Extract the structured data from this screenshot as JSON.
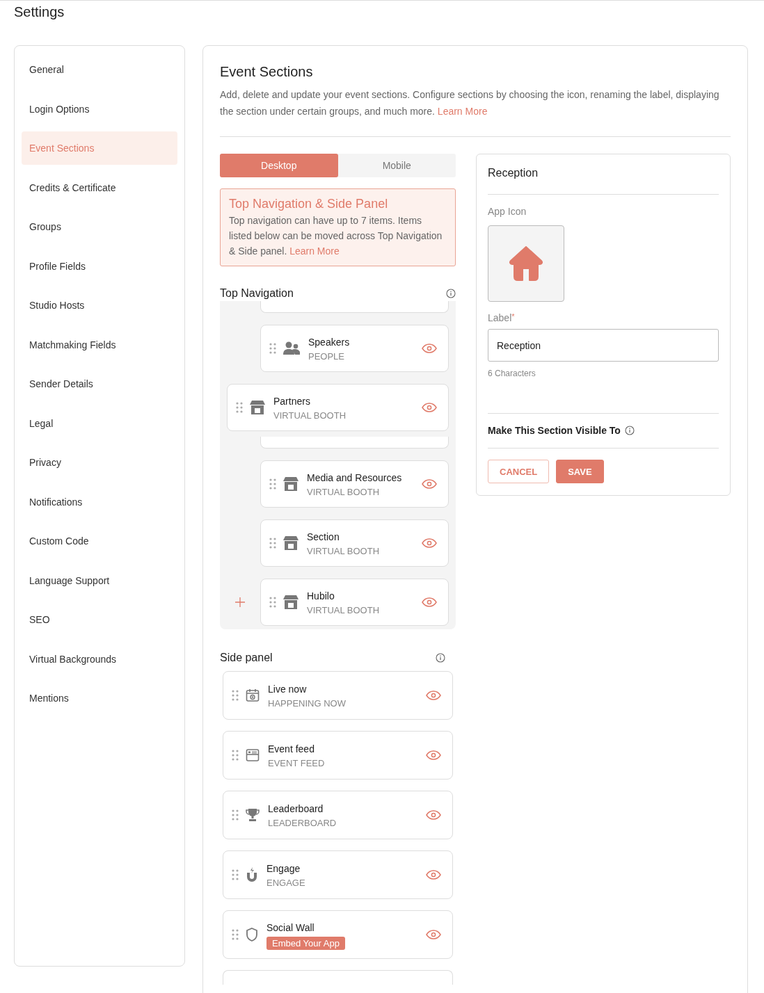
{
  "page_title": "Settings",
  "sidebar": {
    "items": [
      {
        "label": "General",
        "selected": false
      },
      {
        "label": "Login Options",
        "selected": false
      },
      {
        "label": "Event Sections",
        "selected": true
      },
      {
        "label": "Credits & Certificate",
        "selected": false
      },
      {
        "label": "Groups",
        "selected": false
      },
      {
        "label": "Profile Fields",
        "selected": false
      },
      {
        "label": "Studio Hosts",
        "selected": false
      },
      {
        "label": "Matchmaking Fields",
        "selected": false
      },
      {
        "label": "Sender Details",
        "selected": false
      },
      {
        "label": "Legal",
        "selected": false
      },
      {
        "label": "Privacy",
        "selected": false
      },
      {
        "label": "Notifications",
        "selected": false
      },
      {
        "label": "Custom Code",
        "selected": false
      },
      {
        "label": "Language Support",
        "selected": false
      },
      {
        "label": "SEO",
        "selected": false
      },
      {
        "label": "Virtual Backgrounds",
        "selected": false
      },
      {
        "label": "Mentions",
        "selected": false
      }
    ]
  },
  "header": {
    "title": "Event Sections",
    "description": "Add, delete and update your event sections. Configure sections by choosing the icon, renaming the label, displaying the section under certain groups, and much more.",
    "link": "Learn More"
  },
  "tabs": [
    {
      "label": "Desktop",
      "selected": true
    },
    {
      "label": "Mobile",
      "selected": false
    }
  ],
  "info_box": {
    "title": "Top Navigation & Side Panel",
    "text": "Top navigation can have up to 7 items. Items listed below can be moved across Top Navigation & Side panel.",
    "link": "Learn More"
  },
  "top_navigation": {
    "title": "Top Navigation",
    "items": [
      {
        "kind": "stub"
      },
      {
        "kind": "item",
        "name": "Speakers",
        "type": "PEOPLE",
        "visible": true
      },
      {
        "kind": "dragged",
        "name": "Partners",
        "type": "VIRTUAL BOOTH",
        "visible": true
      },
      {
        "kind": "stub"
      },
      {
        "kind": "item",
        "name": "Media and Resources",
        "type": "VIRTUAL BOOTH",
        "visible": true
      },
      {
        "kind": "item",
        "name": "Section",
        "type": "VIRTUAL BOOTH",
        "visible": true
      },
      {
        "kind": "item",
        "name": "Hubilo",
        "type": "VIRTUAL BOOTH",
        "visible": true
      }
    ]
  },
  "side_panel": {
    "title": "Side panel",
    "items": [
      {
        "kind": "item",
        "name": "Live now",
        "type": "HAPPENING NOW",
        "visible": true
      },
      {
        "kind": "item",
        "name": "Event feed",
        "type": "EVENT FEED",
        "visible": true
      },
      {
        "kind": "item",
        "name": "Leaderboard",
        "type": "LEADERBOARD",
        "visible": true
      },
      {
        "kind": "item",
        "name": "Engage",
        "type": "ENGAGE",
        "visible": true
      },
      {
        "kind": "badge",
        "name": "Social Wall",
        "badge": "Embed Your App",
        "visible": true
      },
      {
        "kind": "stub"
      }
    ]
  },
  "editor": {
    "title": "Reception",
    "app_icon_label": "App Icon",
    "label_label": "Label",
    "required_mark": "*",
    "label_value": "Reception",
    "char_count": "6 Characters",
    "visibility": "Make This Section Visible To",
    "buttons": [
      "CANCEL",
      "SAVE"
    ]
  }
}
